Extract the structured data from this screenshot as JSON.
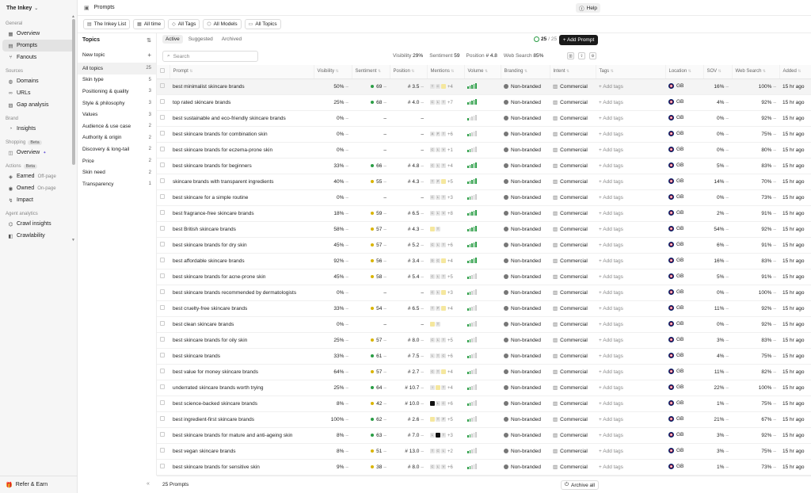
{
  "workspace": {
    "name": "The Inkey"
  },
  "sidebar": {
    "sections": [
      {
        "title": "General",
        "items": [
          {
            "label": "Overview",
            "icon": "grid-icon"
          },
          {
            "label": "Prompts",
            "icon": "message-icon",
            "active": true
          },
          {
            "label": "Fanouts",
            "icon": "branch-icon"
          }
        ]
      },
      {
        "title": "Sources",
        "items": [
          {
            "label": "Domains",
            "icon": "globe-icon"
          },
          {
            "label": "URLs",
            "icon": "link-icon"
          },
          {
            "label": "Gap analysis",
            "icon": "chart-icon"
          }
        ]
      },
      {
        "title": "Brand",
        "items": [
          {
            "label": "Insights",
            "icon": "insights-icon"
          }
        ]
      },
      {
        "title": "Shopping",
        "badge": "Beta",
        "items": [
          {
            "label": "Overview",
            "icon": "bag-icon",
            "sparkle": true
          }
        ]
      },
      {
        "title": "Actions",
        "badge": "Beta",
        "items": [
          {
            "label": "Earned",
            "sub": "Off-page",
            "icon": "earned-icon"
          },
          {
            "label": "Owned",
            "sub": "On-page",
            "icon": "owned-icon"
          },
          {
            "label": "Impact",
            "icon": "impact-icon"
          }
        ]
      },
      {
        "title": "Agent analytics",
        "items": [
          {
            "label": "Crawl insights",
            "icon": "crawl-icon"
          },
          {
            "label": "Crawlability",
            "icon": "crawlability-icon"
          }
        ]
      }
    ],
    "refer": "Refer & Earn"
  },
  "topbar": {
    "title": "Prompts",
    "help": "Help"
  },
  "filters": [
    {
      "label": "The Inkey List",
      "icon": "doc-icon"
    },
    {
      "label": "All time",
      "icon": "calendar-icon"
    },
    {
      "label": "All Tags",
      "icon": "tag-icon"
    },
    {
      "label": "All Models",
      "icon": "model-icon"
    },
    {
      "label": "All Topics",
      "icon": "folder-icon"
    }
  ],
  "topics": {
    "title": "Topics",
    "new_topic": "New topic",
    "items": [
      {
        "label": "All topics",
        "count": "25",
        "selected": true
      },
      {
        "label": "Skin type",
        "count": "5"
      },
      {
        "label": "Positioning & quality",
        "count": "3"
      },
      {
        "label": "Style & philosophy",
        "count": "3"
      },
      {
        "label": "Values",
        "count": "3"
      },
      {
        "label": "Audience & use case",
        "count": "2"
      },
      {
        "label": "Authority & origin",
        "count": "2"
      },
      {
        "label": "Discovery & long-tail",
        "count": "2"
      },
      {
        "label": "Price",
        "count": "2"
      },
      {
        "label": "Skin need",
        "count": "2"
      },
      {
        "label": "Transparency",
        "count": "1"
      }
    ]
  },
  "tabs": [
    "Active",
    "Suggested",
    "Archived"
  ],
  "prompt_count": {
    "used": "25",
    "total": "/ 25"
  },
  "add_prompt": "+ Add Prompt",
  "search": {
    "placeholder": "Search"
  },
  "stats": [
    {
      "label": "Visibility",
      "value": "29%"
    },
    {
      "label": "Sentiment",
      "value": "59"
    },
    {
      "label": "Position",
      "value": "# 4.8"
    },
    {
      "label": "Web Search",
      "value": "85%"
    }
  ],
  "columns": [
    "Prompt",
    "Visibility",
    "Sentiment",
    "Position",
    "Mentions",
    "Volume",
    "Branding",
    "Intent",
    "Tags",
    "Location",
    "SOV",
    "Web Search",
    "Added"
  ],
  "colors": {
    "positive": "#2a9d45",
    "neutral": "#d9b400",
    "accent": "#1a1a1a"
  },
  "rows": [
    {
      "prompt": "best minimalist skincare brands",
      "vis": "50%",
      "sent": "69",
      "pos": "# 3.5",
      "ment": [
        "T",
        "C",
        "–"
      ],
      "more": "+4",
      "vol": 3,
      "brand": "Non-branded",
      "intent": "Commercial",
      "tags": "+ Add tags",
      "loc": "GB",
      "sov": "16%",
      "web": "100%",
      "added": "15 hr ago"
    },
    {
      "prompt": "top rated skincare brands",
      "vis": "25%",
      "sent": "68",
      "pos": "# 4.0",
      "ment": [
        "C",
        "L",
        "T"
      ],
      "more": "+7",
      "vol": 3,
      "brand": "Non-branded",
      "intent": "Commercial",
      "tags": "+ Add tags",
      "loc": "GB",
      "sov": "4%",
      "web": "92%",
      "added": "15 hr ago"
    },
    {
      "prompt": "best sustainable and eco-friendly skincare brands",
      "vis": "0%",
      "sent": "–",
      "pos": "–",
      "ment": [],
      "more": "",
      "vol": 1,
      "brand": "Non-branded",
      "intent": "Commercial",
      "tags": "+ Add tags",
      "loc": "GB",
      "sov": "0%",
      "web": "92%",
      "added": "15 hr ago"
    },
    {
      "prompt": "best skincare brands for combination skin",
      "vis": "0%",
      "sent": "–",
      "pos": "–",
      "ment": [
        "A",
        "P",
        "T"
      ],
      "more": "+6",
      "vol": 2,
      "brand": "Non-branded",
      "intent": "Commercial",
      "tags": "+ Add tags",
      "loc": "GB",
      "sov": "0%",
      "web": "75%",
      "added": "15 hr ago"
    },
    {
      "prompt": "best skincare brands for eczema-prone skin",
      "vis": "0%",
      "sent": "–",
      "pos": "–",
      "ment": [
        "C",
        "L",
        "V"
      ],
      "more": "+1",
      "vol": 2,
      "brand": "Non-branded",
      "intent": "Commercial",
      "tags": "+ Add tags",
      "loc": "GB",
      "sov": "0%",
      "web": "80%",
      "added": "15 hr ago"
    },
    {
      "prompt": "best skincare brands for beginners",
      "vis": "33%",
      "sent": "66",
      "pos": "# 4.8",
      "ment": [
        "C",
        "L",
        "T"
      ],
      "more": "+4",
      "vol": 3,
      "brand": "Non-branded",
      "intent": "Commercial",
      "tags": "+ Add tags",
      "loc": "GB",
      "sov": "5%",
      "web": "83%",
      "added": "15 hr ago"
    },
    {
      "prompt": "skincare brands with transparent ingredients",
      "vis": "40%",
      "sent": "55",
      "pos": "# 4.3",
      "ment": [
        "T",
        "P",
        "–"
      ],
      "more": "+5",
      "vol": 3,
      "brand": "Non-branded",
      "intent": "Commercial",
      "tags": "+ Add tags",
      "loc": "GB",
      "sov": "14%",
      "web": "70%",
      "added": "15 hr ago"
    },
    {
      "prompt": "best skincare for a simple routine",
      "vis": "0%",
      "sent": "–",
      "pos": "–",
      "ment": [
        "C",
        "L",
        "T"
      ],
      "more": "+3",
      "vol": 2,
      "brand": "Non-branded",
      "intent": "Commercial",
      "tags": "+ Add tags",
      "loc": "GB",
      "sov": "0%",
      "web": "73%",
      "added": "15 hr ago"
    },
    {
      "prompt": "best fragrance-free skincare brands",
      "vis": "18%",
      "sent": "59",
      "pos": "# 6.5",
      "ment": [
        "C",
        "L",
        "V"
      ],
      "more": "+8",
      "vol": 3,
      "brand": "Non-branded",
      "intent": "Commercial",
      "tags": "+ Add tags",
      "loc": "GB",
      "sov": "2%",
      "web": "91%",
      "added": "15 hr ago"
    },
    {
      "prompt": "best British skincare brands",
      "vis": "58%",
      "sent": "57",
      "pos": "# 4.3",
      "ment": [
        "–",
        "T"
      ],
      "more": "",
      "vol": 4,
      "brand": "Non-branded",
      "intent": "Commercial",
      "tags": "+ Add tags",
      "loc": "GB",
      "sov": "54%",
      "web": "92%",
      "added": "15 hr ago"
    },
    {
      "prompt": "best skincare brands for dry skin",
      "vis": "45%",
      "sent": "57",
      "pos": "# 5.2",
      "ment": [
        "C",
        "L",
        "T"
      ],
      "more": "+6",
      "vol": 3,
      "brand": "Non-branded",
      "intent": "Commercial",
      "tags": "+ Add tags",
      "loc": "GB",
      "sov": "6%",
      "web": "91%",
      "added": "15 hr ago"
    },
    {
      "prompt": "best affordable skincare brands",
      "vis": "92%",
      "sent": "56",
      "pos": "# 3.4",
      "ment": [
        "D",
        "C",
        "–"
      ],
      "more": "+4",
      "vol": 3,
      "brand": "Non-branded",
      "intent": "Commercial",
      "tags": "+ Add tags",
      "loc": "GB",
      "sov": "16%",
      "web": "83%",
      "added": "15 hr ago"
    },
    {
      "prompt": "best skincare brands for acne-prone skin",
      "vis": "45%",
      "sent": "58",
      "pos": "# 5.4",
      "ment": [
        "C",
        "L",
        "T"
      ],
      "more": "+5",
      "vol": 2,
      "brand": "Non-branded",
      "intent": "Commercial",
      "tags": "+ Add tags",
      "loc": "GB",
      "sov": "5%",
      "web": "91%",
      "added": "15 hr ago"
    },
    {
      "prompt": "best skincare brands recommended by dermatologists",
      "vis": "0%",
      "sent": "–",
      "pos": "–",
      "ment": [
        "C",
        "L",
        "–"
      ],
      "more": "+3",
      "vol": 2,
      "brand": "Non-branded",
      "intent": "Commercial",
      "tags": "+ Add tags",
      "loc": "GB",
      "sov": "0%",
      "web": "100%",
      "added": "15 hr ago"
    },
    {
      "prompt": "best cruelty-free skincare brands",
      "vis": "33%",
      "sent": "54",
      "pos": "# 6.5",
      "ment": [
        "T",
        "P",
        "–"
      ],
      "more": "+4",
      "vol": 2,
      "brand": "Non-branded",
      "intent": "Commercial",
      "tags": "+ Add tags",
      "loc": "GB",
      "sov": "11%",
      "web": "92%",
      "added": "15 hr ago"
    },
    {
      "prompt": "best clean skincare brands",
      "vis": "0%",
      "sent": "–",
      "pos": "–",
      "ment": [
        "–",
        "T"
      ],
      "more": "",
      "vol": 2,
      "brand": "Non-branded",
      "intent": "Commercial",
      "tags": "+ Add tags",
      "loc": "GB",
      "sov": "0%",
      "web": "92%",
      "added": "15 hr ago"
    },
    {
      "prompt": "best skincare brands for oily skin",
      "vis": "25%",
      "sent": "57",
      "pos": "# 8.0",
      "ment": [
        "C",
        "L",
        "T"
      ],
      "more": "+5",
      "vol": 2,
      "brand": "Non-branded",
      "intent": "Commercial",
      "tags": "+ Add tags",
      "loc": "GB",
      "sov": "3%",
      "web": "83%",
      "added": "15 hr ago"
    },
    {
      "prompt": "best skincare brands",
      "vis": "33%",
      "sent": "61",
      "pos": "# 7.5",
      "ment": [
        "L",
        "T",
        "C"
      ],
      "more": "+6",
      "vol": 2,
      "brand": "Non-branded",
      "intent": "Commercial",
      "tags": "+ Add tags",
      "loc": "GB",
      "sov": "4%",
      "web": "75%",
      "added": "15 hr ago"
    },
    {
      "prompt": "best value for money skincare brands",
      "vis": "64%",
      "sent": "57",
      "pos": "# 2.7",
      "ment": [
        "C",
        "T",
        "–"
      ],
      "more": "+4",
      "vol": 2,
      "brand": "Non-branded",
      "intent": "Commercial",
      "tags": "+ Add tags",
      "loc": "GB",
      "sov": "11%",
      "web": "82%",
      "added": "15 hr ago"
    },
    {
      "prompt": "underrated skincare brands worth trying",
      "vis": "25%",
      "sent": "64",
      "pos": "# 10.7",
      "ment": [
        "I",
        "–",
        "T"
      ],
      "more": "+4",
      "vol": 2,
      "brand": "Non-branded",
      "intent": "Commercial",
      "tags": "+ Add tags",
      "loc": "GB",
      "sov": "22%",
      "web": "100%",
      "added": "15 hr ago"
    },
    {
      "prompt": "best science-backed skincare brands",
      "vis": "8%",
      "sent": "42",
      "pos": "# 10.0",
      "ment": [
        "■",
        "L",
        "C"
      ],
      "more": "+6",
      "vol": 2,
      "brand": "Non-branded",
      "intent": "Commercial",
      "tags": "+ Add tags",
      "loc": "GB",
      "sov": "1%",
      "web": "75%",
      "added": "15 hr ago"
    },
    {
      "prompt": "best ingredient-first skincare brands",
      "vis": "100%",
      "sent": "62",
      "pos": "# 2.6",
      "ment": [
        "–",
        "T",
        "P"
      ],
      "more": "+5",
      "vol": 2,
      "brand": "Non-branded",
      "intent": "Commercial",
      "tags": "+ Add tags",
      "loc": "GB",
      "sov": "21%",
      "web": "67%",
      "added": "15 hr ago"
    },
    {
      "prompt": "best skincare brands for mature and anti-ageing skin",
      "vis": "8%",
      "sent": "63",
      "pos": "# 7.0",
      "ment": [
        "L",
        "■",
        "T"
      ],
      "more": "+3",
      "vol": 2,
      "brand": "Non-branded",
      "intent": "Commercial",
      "tags": "+ Add tags",
      "loc": "GB",
      "sov": "3%",
      "web": "92%",
      "added": "15 hr ago"
    },
    {
      "prompt": "best vegan skincare brands",
      "vis": "8%",
      "sent": "51",
      "pos": "# 13.0",
      "ment": [
        "T",
        "C",
        "L"
      ],
      "more": "+2",
      "vol": 2,
      "brand": "Non-branded",
      "intent": "Commercial",
      "tags": "+ Add tags",
      "loc": "GB",
      "sov": "3%",
      "web": "75%",
      "added": "15 hr ago"
    },
    {
      "prompt": "best skincare brands for sensitive skin",
      "vis": "9%",
      "sent": "38",
      "pos": "# 8.0",
      "ment": [
        "C",
        "L",
        "V"
      ],
      "more": "+6",
      "vol": 2,
      "brand": "Non-branded",
      "intent": "Commercial",
      "tags": "+ Add tags",
      "loc": "GB",
      "sov": "1%",
      "web": "73%",
      "added": "15 hr ago"
    }
  ],
  "footer": {
    "count": "25 Prompts",
    "archive": "Archive all"
  }
}
